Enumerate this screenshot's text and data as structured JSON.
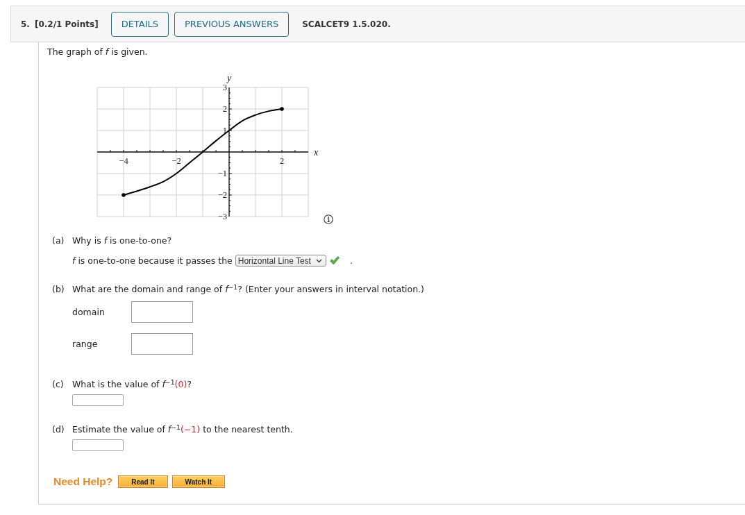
{
  "header": {
    "number": "5.",
    "points": "[0.2/1 Points]",
    "buttons": [
      "DETAILS",
      "PREVIOUS ANSWERS"
    ],
    "code": "SCALCET9 1.5.020."
  },
  "intro": "The graph of *f* is given.",
  "figure": {
    "chart_data": {
      "type": "line",
      "xlabel": "x",
      "ylabel": "y",
      "x": [
        -4,
        -3.5,
        -3,
        -2.5,
        -2,
        -1.5,
        -1,
        -0.5,
        0,
        0.5,
        1,
        1.5,
        2
      ],
      "series": [
        {
          "color": "#000000",
          "values": [
            -2,
            -1.82,
            -1.62,
            -1.38,
            -1,
            -0.5,
            0,
            0.52,
            1,
            1.45,
            1.72,
            1.9,
            2
          ]
        }
      ],
      "xlim": [
        -5,
        3
      ],
      "ylim": [
        -3,
        3
      ],
      "xticks": [
        {
          "value": -4,
          "label": "−4"
        },
        {
          "value": -2,
          "label": "−2"
        },
        2
      ],
      "yticks": [
        {
          "value": -3,
          "label": "−3"
        },
        {
          "value": -2,
          "label": "−2"
        },
        {
          "value": -1,
          "label": "−1"
        },
        1,
        2,
        3
      ],
      "grid": true
    }
  },
  "parts": [
    {
      "kind": "select",
      "label": "(a)",
      "question": [
        {
          "text": "Why is *f* is one-to-one?",
          "highlighted": false
        }
      ],
      "sentence": "*f* is one-to-one because it passes the",
      "select": {
        "value": "Horizontal Line Test",
        "correct": true
      },
      "sentence_end": "."
    },
    {
      "kind": "labeled_fields",
      "label": "(b)",
      "question": [
        {
          "text": "What are the domain and range of *f*$^{−1}$? (Enter your answers in interval notation.)",
          "highlighted": false
        }
      ],
      "fields": [
        {
          "label": "domain"
        },
        {
          "label": "range"
        }
      ]
    },
    {
      "kind": "blank",
      "label": "(c)",
      "question": [
        {
          "text": "What is the value of *f*$^{−1}$",
          "highlighted": false
        },
        {
          "text": "(0)",
          "highlighted": true
        },
        {
          "text": "?",
          "highlighted": false
        }
      ]
    },
    {
      "kind": "blank",
      "label": "(d)",
      "question": [
        {
          "text": "Estimate the value of *f*$^{−1}$",
          "highlighted": false
        },
        {
          "text": "(−1)",
          "highlighted": true
        },
        {
          "text": " to the nearest tenth.",
          "highlighted": false
        }
      ]
    }
  ],
  "help": {
    "label": "Need Help?",
    "buttons": [
      "Read It",
      "Watch It"
    ]
  }
}
